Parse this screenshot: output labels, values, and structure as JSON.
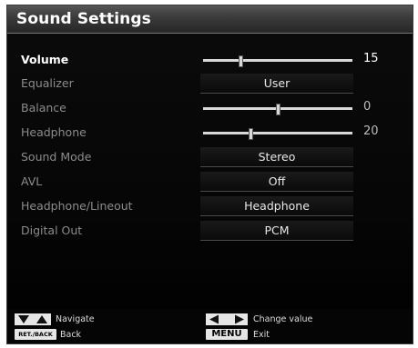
{
  "title": "Sound Settings",
  "rows": [
    {
      "label": "Volume",
      "value": "15",
      "level": 0.25
    },
    {
      "label": "Equalizer",
      "value": "User"
    },
    {
      "label": "Balance",
      "value": "0",
      "level": 0.5
    },
    {
      "label": "Headphone",
      "value": "20",
      "level": 0.32
    },
    {
      "label": "Sound Mode",
      "value": "Stereo"
    },
    {
      "label": "AVL",
      "value": "Off"
    },
    {
      "label": "Headphone/Lineout",
      "value": "Headphone"
    },
    {
      "label": "Digital Out",
      "value": "PCM"
    }
  ],
  "footer": {
    "navigate": "Navigate",
    "change_value": "Change value",
    "back_key": "RET./BACK",
    "back": "Back",
    "menu_key": "MENU",
    "exit": "Exit"
  }
}
